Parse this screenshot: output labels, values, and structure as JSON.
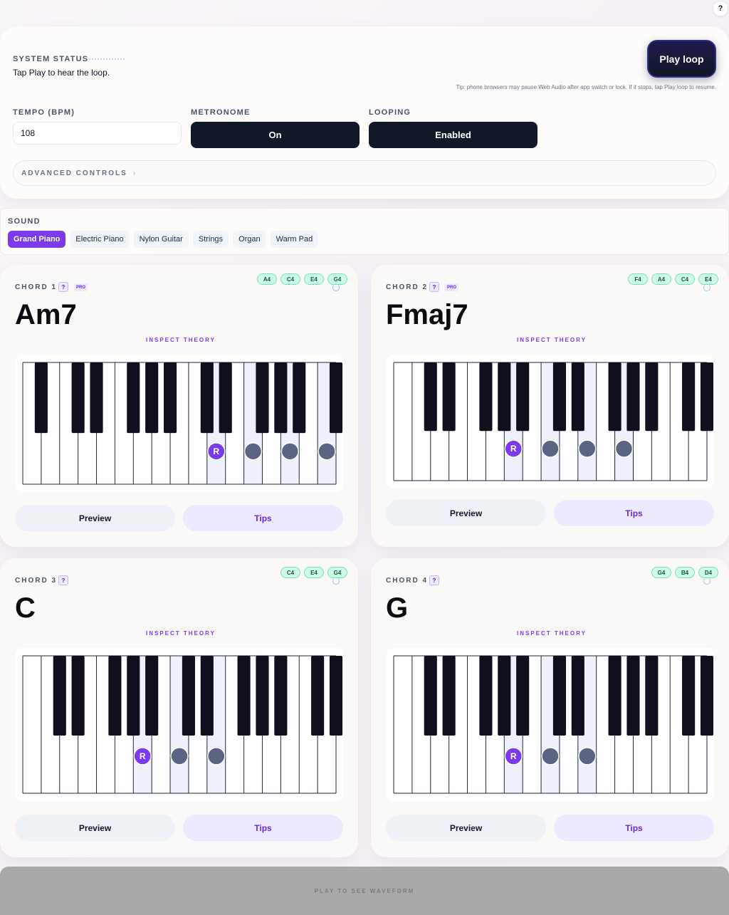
{
  "help": {
    "label": "?"
  },
  "status": {
    "label": "SYSTEM STATUS",
    "message": "Tap Play to hear the loop.",
    "play_button": "Play loop",
    "tip": "Tip: phone browsers may pause Web Audio after app switch or lock. If it stops, tap Play loop to resume."
  },
  "controls": {
    "tempo_label": "TEMPO (BPM)",
    "tempo_value": "108",
    "metronome_label": "METRONOME",
    "metronome_value": "On",
    "looping_label": "LOOPING",
    "looping_value": "Enabled",
    "advanced_label": "ADVANCED CONTROLS",
    "advanced_chevron": "›"
  },
  "sound": {
    "label": "SOUND",
    "options": [
      "Grand Piano",
      "Electric Piano",
      "Nylon Guitar",
      "Strings",
      "Organ",
      "Warm Pad"
    ],
    "selected": "Grand Piano"
  },
  "chords": [
    {
      "label": "CHORD 1",
      "name": "Am7",
      "help": "?",
      "pro": "PRO",
      "notes": [
        "A4",
        "C4",
        "E4",
        "G4"
      ],
      "inspect": "INSPECT THEORY",
      "preview": "Preview",
      "tips": "Tips",
      "root_marker": "R"
    },
    {
      "label": "CHORD 2",
      "name": "Fmaj7",
      "help": "?",
      "pro": "PRO",
      "notes": [
        "F4",
        "A4",
        "C4",
        "E4"
      ],
      "inspect": "INSPECT THEORY",
      "preview": "Preview",
      "tips": "Tips",
      "root_marker": "R"
    },
    {
      "label": "CHORD 3",
      "name": "C",
      "help": "?",
      "notes": [
        "C4",
        "E4",
        "G4"
      ],
      "inspect": "INSPECT THEORY",
      "preview": "Preview",
      "tips": "Tips",
      "root_marker": "R"
    },
    {
      "label": "CHORD 4",
      "name": "G",
      "help": "?",
      "notes": [
        "G4",
        "B4",
        "D4"
      ],
      "inspect": "INSPECT THEORY",
      "preview": "Preview",
      "tips": "Tips",
      "root_marker": "R"
    }
  ],
  "colors": {
    "accent": "#7c3aed",
    "dark": "#111827",
    "note_dot": "#5b6583",
    "chip_green": "#d1fae5"
  },
  "waveform": {
    "placeholder": "PLAY TO SEE WAVEFORM"
  }
}
